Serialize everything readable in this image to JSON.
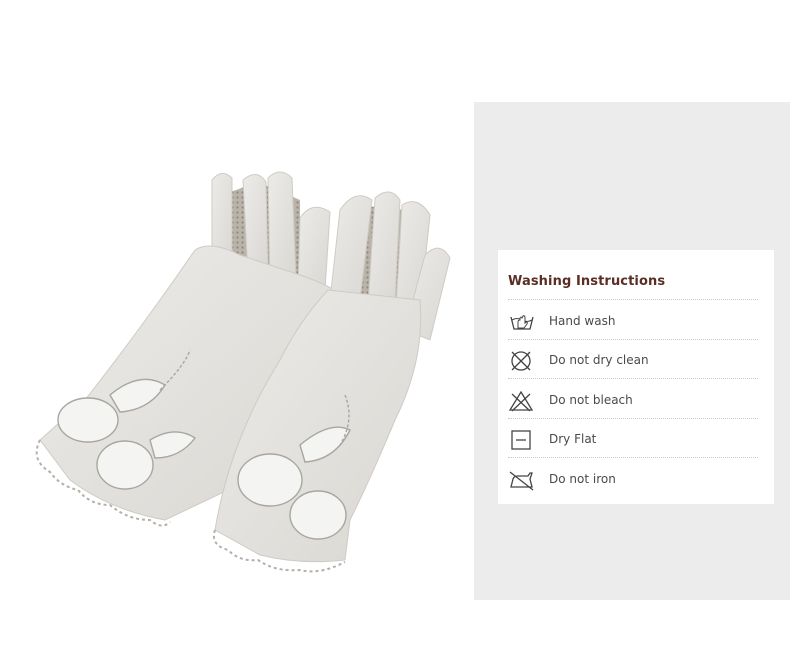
{
  "product": {
    "image_alt": "Pair of light grey gloves with silver floral embroidery and scalloped lace cuffs"
  },
  "washing": {
    "title": "Washing Instructions",
    "items": [
      {
        "label": "Hand wash",
        "icon": "hand-wash-icon"
      },
      {
        "label": "Do not dry clean",
        "icon": "do-not-dry-clean-icon"
      },
      {
        "label": "Do not bleach",
        "icon": "do-not-bleach-icon"
      },
      {
        "label": "Dry Flat",
        "icon": "dry-flat-icon"
      },
      {
        "label": "Do not iron",
        "icon": "do-not-iron-icon"
      }
    ]
  },
  "colors": {
    "title": "#5a2e24",
    "text": "#4a4a4a",
    "panel": "#ececec",
    "glove": "#e4e2de"
  }
}
